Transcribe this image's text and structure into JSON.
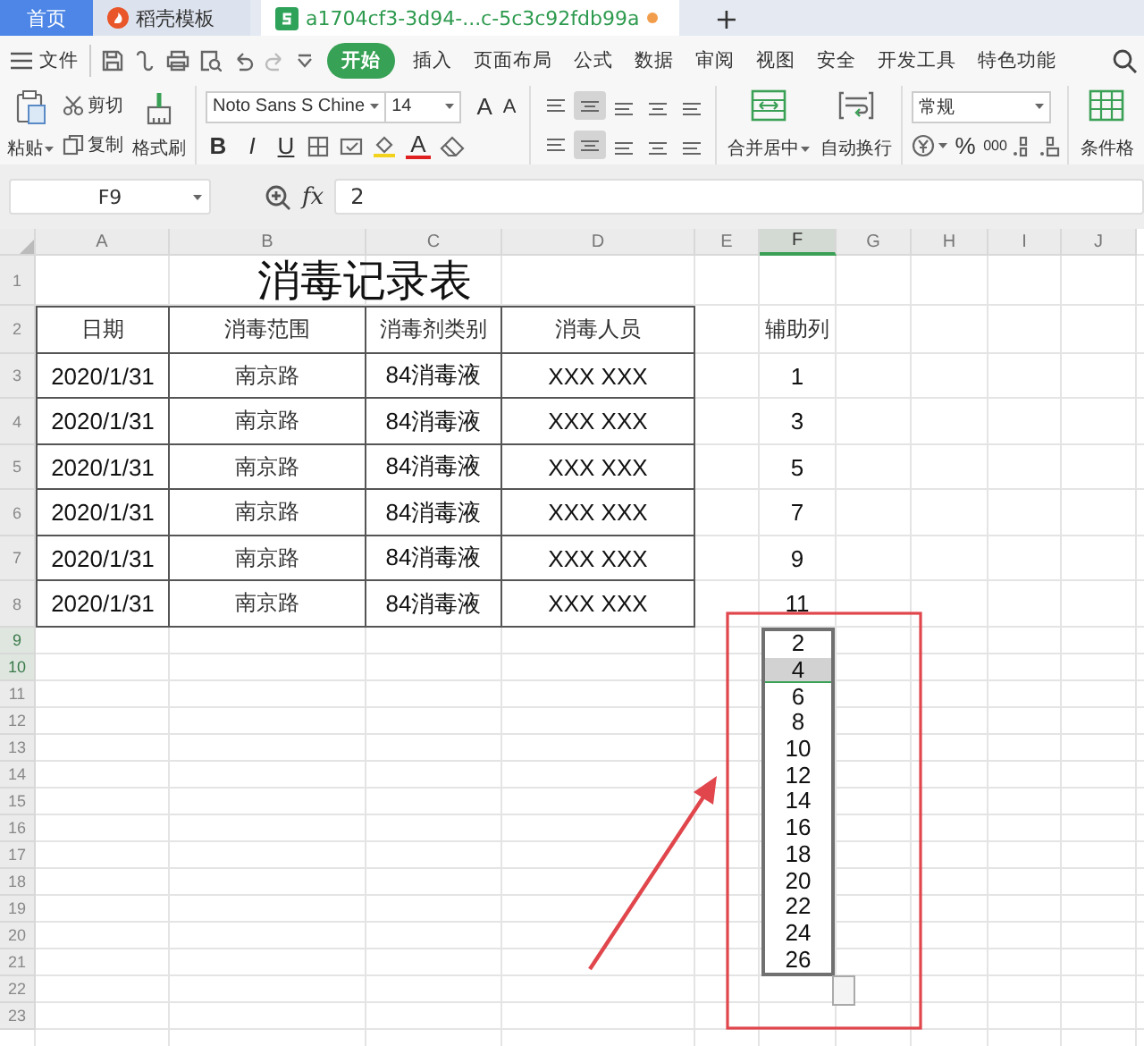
{
  "tabs": [
    {
      "label": "首页",
      "kind": "home",
      "selected": false,
      "unsaved": false
    },
    {
      "label": "稻壳模板",
      "kind": "docer",
      "selected": false,
      "unsaved": false
    },
    {
      "label": "a1704cf3-3d94-...c-5c3c92fdb99a",
      "kind": "sheet",
      "selected": true,
      "unsaved": true
    }
  ],
  "new_tab": "+",
  "menu": {
    "file": "文件",
    "tabs": [
      {
        "label": "开始",
        "selected": true
      },
      {
        "label": "插入",
        "selected": false
      },
      {
        "label": "页面布局",
        "selected": false
      },
      {
        "label": "公式",
        "selected": false
      },
      {
        "label": "数据",
        "selected": false
      },
      {
        "label": "审阅",
        "selected": false
      },
      {
        "label": "视图",
        "selected": false
      },
      {
        "label": "安全",
        "selected": false
      },
      {
        "label": "开发工具",
        "selected": false
      },
      {
        "label": "特色功能",
        "selected": false
      }
    ]
  },
  "ribbon": {
    "paste": "粘贴",
    "cut": "剪切",
    "copy": "复制",
    "format_painter": "格式刷",
    "font_name": "Noto Sans S Chine",
    "font_size": "14",
    "grow_font": "A",
    "shrink_font": "A",
    "bold": "B",
    "italic": "I",
    "underline": "U",
    "font_color": "A",
    "align_rows": [
      [
        {
          "selected": false
        },
        {
          "selected": true
        },
        {
          "selected": false
        },
        {
          "selected": false
        },
        {
          "selected": false
        }
      ],
      [
        {
          "selected": false
        },
        {
          "selected": true
        },
        {
          "selected": false
        },
        {
          "selected": false
        },
        {
          "selected": false
        }
      ]
    ],
    "merge_center": "合并居中",
    "wrap_text": "自动换行",
    "number_format": "常规",
    "percent": "%",
    "thousands": "000",
    "conditional_format": "条件格"
  },
  "formula_bar": {
    "name_box": "F9",
    "function_label": "fx",
    "formula": "2"
  },
  "columns": [
    {
      "label": "A",
      "selected": false
    },
    {
      "label": "B",
      "selected": false
    },
    {
      "label": "C",
      "selected": false
    },
    {
      "label": "D",
      "selected": false
    },
    {
      "label": "E",
      "selected": false
    },
    {
      "label": "F",
      "selected": true
    },
    {
      "label": "G",
      "selected": false
    },
    {
      "label": "H",
      "selected": false
    },
    {
      "label": "I",
      "selected": false
    },
    {
      "label": "J",
      "selected": false
    }
  ],
  "row_headers": [
    {
      "label": "1",
      "selected": false
    },
    {
      "label": "2",
      "selected": false
    },
    {
      "label": "3",
      "selected": false
    },
    {
      "label": "4",
      "selected": false
    },
    {
      "label": "5",
      "selected": false
    },
    {
      "label": "6",
      "selected": false
    },
    {
      "label": "7",
      "selected": false
    },
    {
      "label": "8",
      "selected": false
    },
    {
      "label": "9",
      "selected": true
    },
    {
      "label": "10",
      "selected": true
    },
    {
      "label": "11",
      "selected": false
    },
    {
      "label": "12",
      "selected": false
    },
    {
      "label": "13",
      "selected": false
    },
    {
      "label": "14",
      "selected": false
    },
    {
      "label": "15",
      "selected": false
    },
    {
      "label": "16",
      "selected": false
    },
    {
      "label": "17",
      "selected": false
    },
    {
      "label": "18",
      "selected": false
    },
    {
      "label": "19",
      "selected": false
    },
    {
      "label": "20",
      "selected": false
    },
    {
      "label": "21",
      "selected": false
    },
    {
      "label": "22",
      "selected": false
    },
    {
      "label": "23",
      "selected": false
    }
  ],
  "table": {
    "title": "消毒记录表",
    "header": [
      "日期",
      "消毒范围",
      "消毒剂类别",
      "消毒人员"
    ],
    "rows": [
      [
        "2020/1/31",
        "南京路",
        "84消毒液",
        "XXX XXX"
      ],
      [
        "2020/1/31",
        "南京路",
        "84消毒液",
        "XXX XXX"
      ],
      [
        "2020/1/31",
        "南京路",
        "84消毒液",
        "XXX XXX"
      ],
      [
        "2020/1/31",
        "南京路",
        "84消毒液",
        "XXX XXX"
      ],
      [
        "2020/1/31",
        "南京路",
        "84消毒液",
        "XXX XXX"
      ],
      [
        "2020/1/31",
        "南京路",
        "84消毒液",
        "XXX XXX"
      ]
    ]
  },
  "helper_column": {
    "header": "辅助列",
    "values": [
      "1",
      "3",
      "5",
      "7",
      "9",
      "11"
    ]
  },
  "dropdown_list": {
    "items": [
      {
        "label": "2",
        "selected": false
      },
      {
        "label": "4",
        "selected": true
      },
      {
        "label": "6",
        "selected": false
      },
      {
        "label": "8",
        "selected": false
      },
      {
        "label": "10",
        "selected": false
      },
      {
        "label": "12",
        "selected": false
      },
      {
        "label": "14",
        "selected": false
      },
      {
        "label": "16",
        "selected": false
      },
      {
        "label": "18",
        "selected": false
      },
      {
        "label": "20",
        "selected": false
      },
      {
        "label": "22",
        "selected": false
      },
      {
        "label": "24",
        "selected": false
      },
      {
        "label": "26",
        "selected": false
      }
    ]
  }
}
